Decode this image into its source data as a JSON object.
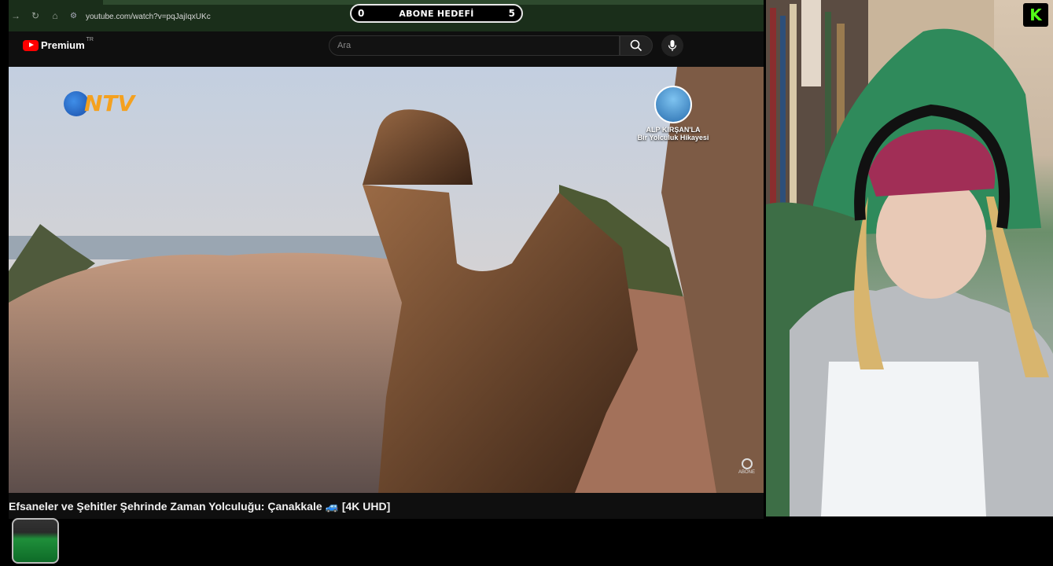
{
  "goal_overlay": {
    "title": "ABONE HEDEFİ",
    "current": "0",
    "target": "5"
  },
  "browser": {
    "url": "youtube.com/watch?v=pqJajIqxUKc"
  },
  "youtube": {
    "brand": "Premium",
    "region": "TR",
    "search_placeholder": "Ara",
    "video_title": "Efsaneler ve Şehitler Şehrinde Zaman Yolculuğu: Çanakkale 🚙 [4K UHD]"
  },
  "video_overlay": {
    "broadcaster_logo": "NTV",
    "channel_name": "ALP KIRŞAN'LA",
    "channel_subtitle": "Bir Yolculuk Hikayesi",
    "subscribe_watermark": "ABONE"
  },
  "platform_logo": "K",
  "colors": {
    "accent_red": "#ff0000",
    "kick_green": "#53fc18",
    "ntv_orange": "#f4a11f"
  }
}
